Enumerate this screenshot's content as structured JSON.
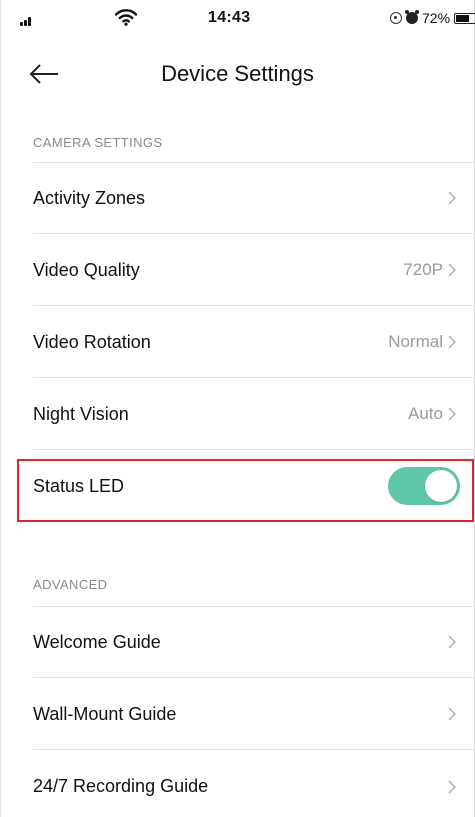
{
  "status_bar": {
    "time": "14:43",
    "battery": "72%",
    "battery_level": 0.72
  },
  "header": {
    "title": "Device Settings",
    "back_icon": "arrow-left-icon"
  },
  "camera_settings": {
    "section_label": "CAMERA SETTINGS",
    "items": [
      {
        "label": "Activity Zones",
        "value": ""
      },
      {
        "label": "Video Quality",
        "value": "720P"
      },
      {
        "label": "Video Rotation",
        "value": "Normal"
      },
      {
        "label": "Night Vision",
        "value": "Auto"
      }
    ],
    "status_led": {
      "label": "Status LED",
      "enabled": true,
      "toggle_color": "#5fc7a7"
    }
  },
  "advanced": {
    "section_label": "ADVANCED",
    "items": [
      {
        "label": "Welcome Guide"
      },
      {
        "label": "Wall-Mount Guide"
      },
      {
        "label": "24/7 Recording Guide"
      }
    ]
  },
  "colors": {
    "accent": "#5fc7a7",
    "highlight": "#e0242b",
    "muted_text": "#9a9a9a"
  }
}
